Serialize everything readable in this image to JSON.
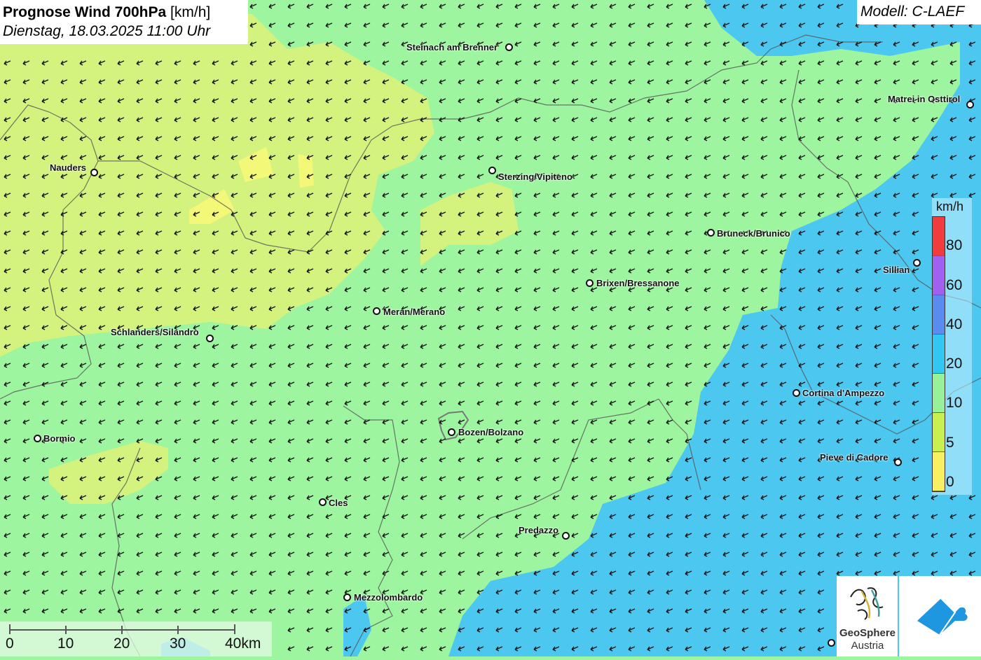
{
  "title": {
    "bold": "Prognose Wind 700hPa",
    "unit": "[km/h]",
    "datetime": "Dienstag, 18.03.2025 11:00 Uhr"
  },
  "model": "Modell: C-LAEF",
  "cities": [
    {
      "name": "Steinach am Brenner"
    },
    {
      "name": "Matrei in Osttirol"
    },
    {
      "name": "Nauders"
    },
    {
      "name": "Sterzing/Vipiteno"
    },
    {
      "name": "Bruneck/Brunico"
    },
    {
      "name": "Sillian"
    },
    {
      "name": "Brixen/Bressanone"
    },
    {
      "name": "Meran/Merano"
    },
    {
      "name": "Schlanders/Silandro"
    },
    {
      "name": "Cortina d'Ampezzo"
    },
    {
      "name": "Bormio"
    },
    {
      "name": "Bozen/Bolzano"
    },
    {
      "name": "Pieve di Cadore"
    },
    {
      "name": "Cles"
    },
    {
      "name": "Predazzo"
    },
    {
      "name": "Mezzolombardo"
    }
  ],
  "legend": {
    "unit": "km/h",
    "labels": [
      "80",
      "60",
      "40",
      "20",
      "10",
      "5",
      "0"
    ],
    "colors": [
      "#f03c3c",
      "#a060f0",
      "#5a8cf0",
      "#30c8f0",
      "#98f098",
      "#c8f050",
      "#f8f060"
    ]
  },
  "scale": {
    "labels": [
      "0",
      "10",
      "20",
      "30",
      "40km"
    ]
  },
  "logo": {
    "line1": "GeoSphere",
    "line2": "Austria"
  },
  "wind": {
    "direction": "from east-northeast",
    "ranges": [
      {
        "label": "0-5",
        "color": "#e8f870"
      },
      {
        "label": "5-10",
        "color": "#c8f080"
      },
      {
        "label": "10-20",
        "color": "#9df59f"
      },
      {
        "label": "20-40",
        "color": "#4cc8f0"
      }
    ]
  }
}
